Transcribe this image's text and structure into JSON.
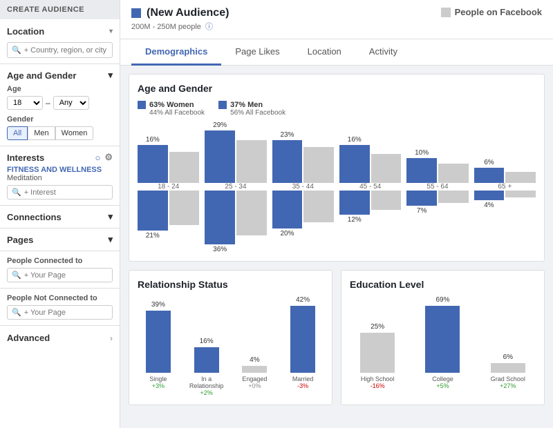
{
  "sidebar": {
    "header": "CREATE AUDIENCE",
    "location": {
      "label": "Location",
      "placeholder": "+ Country, region, or city"
    },
    "age_gender": {
      "label": "Age and Gender",
      "age_label": "Age",
      "age_from": "18",
      "age_to": "Any",
      "gender_label": "Gender",
      "gender_options": [
        "All",
        "Men",
        "Women"
      ],
      "active_gender": "All"
    },
    "interests": {
      "label": "Interests",
      "category": "FITNESS AND WELLNESS",
      "sub": "Meditation",
      "placeholder": "+ Interest"
    },
    "connections": {
      "label": "Connections"
    },
    "pages": {
      "label": "Pages"
    },
    "people_connected_to": {
      "label": "People Connected to",
      "placeholder": "+ Your Page"
    },
    "people_not_connected_to": {
      "label": "People Not Connected to",
      "placeholder": "+ Your Page"
    },
    "advanced": {
      "label": "Advanced"
    }
  },
  "audience": {
    "title": "(New Audience)",
    "size": "200M - 250M people",
    "people_on_fb": "People on Facebook"
  },
  "tabs": [
    "Demographics",
    "Page Likes",
    "Location",
    "Activity"
  ],
  "active_tab": "Demographics",
  "age_gender_chart": {
    "title": "Age and Gender",
    "legend_women": "63% Women",
    "legend_women_sub": "44% All Facebook",
    "legend_men": "37% Men",
    "legend_men_sub": "56% All Facebook",
    "age_groups": [
      "18 - 24",
      "25 - 34",
      "35 - 44",
      "45 - 54",
      "55 - 64",
      "65 +"
    ],
    "women_pct": [
      16,
      29,
      23,
      16,
      10,
      6
    ],
    "men_pct": [
      21,
      36,
      20,
      12,
      7,
      4
    ],
    "women_fb_pct": [
      14,
      24,
      20,
      14,
      9,
      5
    ],
    "men_fb_pct": [
      18,
      30,
      17,
      10,
      6,
      3
    ]
  },
  "relationship_chart": {
    "title": "Relationship Status",
    "bars": [
      {
        "label": "Single",
        "pct": 39,
        "change": "+3%",
        "change_type": "green"
      },
      {
        "label": "In a Relationship",
        "pct": 16,
        "change": "+2%",
        "change_type": "green"
      },
      {
        "label": "Engaged",
        "pct": 4,
        "change": "+0%",
        "change_type": "gray"
      },
      {
        "label": "Married",
        "pct": 42,
        "change": "-3%",
        "change_type": "red"
      }
    ]
  },
  "education_chart": {
    "title": "Education Level",
    "bars": [
      {
        "label": "High School",
        "pct": 25,
        "change": "-16%",
        "change_type": "red",
        "type": "gray"
      },
      {
        "label": "College",
        "pct": 69,
        "change": "+5%",
        "change_type": "green",
        "type": "blue"
      },
      {
        "label": "Grad School",
        "pct": 6,
        "change": "+27%",
        "change_type": "green",
        "type": "gray"
      }
    ]
  },
  "colors": {
    "accent": "#4267b2",
    "gray": "#ccc",
    "green": "#2d9e2d",
    "red": "#cc0000"
  }
}
